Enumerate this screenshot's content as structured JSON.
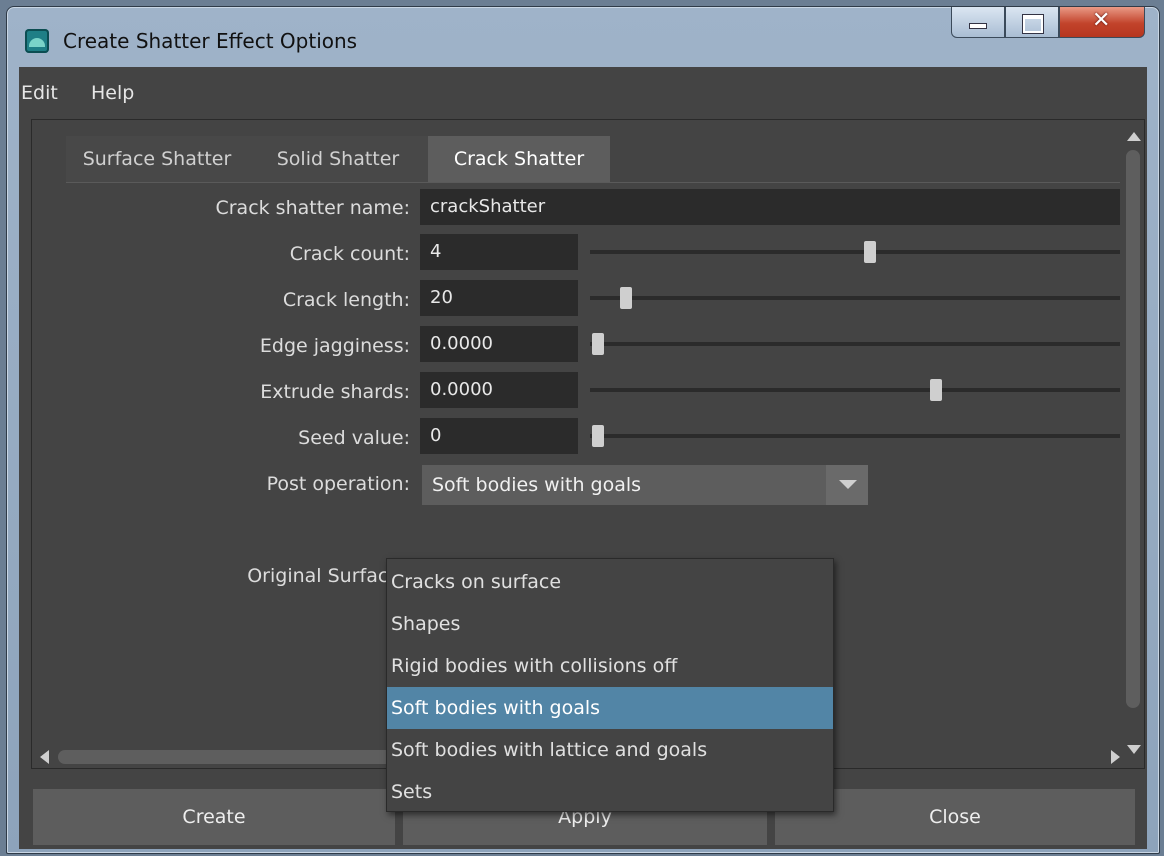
{
  "window": {
    "title": "Create Shatter Effect Options",
    "buttons": [
      "minimize",
      "maximize",
      "close"
    ]
  },
  "menubar": {
    "items": [
      "Edit",
      "Help"
    ]
  },
  "tabs": [
    {
      "label": "Surface Shatter",
      "active": false
    },
    {
      "label": "Solid Shatter",
      "active": false
    },
    {
      "label": "Crack Shatter",
      "active": true
    }
  ],
  "form": {
    "name_label": "Crack shatter name:",
    "name_value": "crackShatter",
    "rows": [
      {
        "label": "Crack count:",
        "value": "4"
      },
      {
        "label": "Crack length:",
        "value": "20"
      },
      {
        "label": "Edge jagginess:",
        "value": "0.0000"
      },
      {
        "label": "Extrude shards:",
        "value": "0.0000"
      },
      {
        "label": "Seed value:",
        "value": "0"
      }
    ],
    "post_operation_label": "Post operation:",
    "post_operation_value": "Soft bodies with goals",
    "original_surface_label": "Original Surface"
  },
  "dropdown_options": [
    {
      "label": "Cracks on surface",
      "selected": false
    },
    {
      "label": "Shapes",
      "selected": false
    },
    {
      "label": "Rigid bodies with collisions off",
      "selected": false
    },
    {
      "label": "Soft bodies with goals",
      "selected": true
    },
    {
      "label": "Soft bodies with lattice and goals",
      "selected": false
    },
    {
      "label": "Sets",
      "selected": false
    }
  ],
  "bottom_buttons": {
    "create": "Create",
    "apply": "Apply",
    "close": "Close"
  },
  "colors": {
    "panel": "#444444",
    "field": "#2b2b2b",
    "selection": "#5285a6"
  },
  "icons": [
    "maya-app-icon",
    "minimize-icon",
    "maximize-icon",
    "close-icon",
    "dropdown-arrow-icon",
    "scroll-up-icon",
    "scroll-down-icon",
    "scroll-left-icon",
    "scroll-right-icon"
  ]
}
